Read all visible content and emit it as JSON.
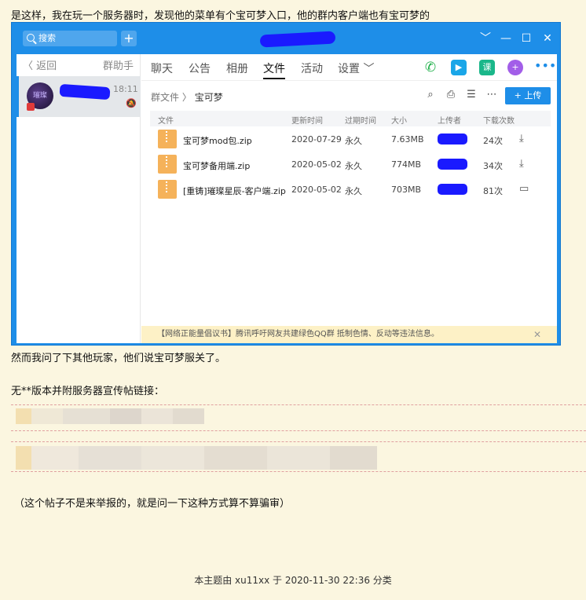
{
  "post": {
    "intro": "是这样，我在玩一个服务器时，发现他的菜单有个宝可梦入口，他的群内客户端也有宝可梦的",
    "after_screenshot": "然而我问了下其他玩家，他们说宝可梦服关了。",
    "links_intro": "无**版本并附服务器宣传帖链接：",
    "question": "（这个帖子不是来举报的，就是问一下这种方式算不算骗审）",
    "footer": "本主题由 xu11xx 于 2020-11-30 22:36 分类"
  },
  "qq_window": {
    "search_placeholder": "搜索",
    "add_symbol": "+",
    "controls": [
      "﹀",
      "—",
      "☐",
      "✕"
    ],
    "left_panel": {
      "back_label": "〈 返回",
      "assistant_label": "群助手",
      "chat_time": "18:11",
      "avatar_text": "璀璨"
    },
    "tabs": [
      "聊天",
      "公告",
      "相册",
      "文件",
      "活动",
      "设置 ﹀"
    ],
    "active_tab": "文件",
    "toolbar_icons": [
      "phone-icon",
      "video-icon",
      "class-icon",
      "plus-app-icon",
      "more-icon"
    ],
    "class_icon_text": "课",
    "plus_app_text": "+",
    "more_text": "•••",
    "path": {
      "root": "群文件",
      "separator": "〉",
      "current": "宝可梦"
    },
    "path_tool_icons": [
      "search-icon",
      "inbox-icon",
      "list-icon",
      "more-icon"
    ],
    "upload_label": "+ 上传",
    "columns": [
      "文件",
      "更新时间",
      "过期时间",
      "大小",
      "上传者",
      "下载次数"
    ],
    "files": [
      {
        "name": "宝可梦mod包.zip",
        "date": "2020-07-29",
        "expire": "永久",
        "size": "7.63MB",
        "downloads": "24次",
        "action_icon": "download-icon"
      },
      {
        "name": "宝可梦备用端.zip",
        "date": "2020-05-02",
        "expire": "永久",
        "size": "774MB",
        "downloads": "34次",
        "action_icon": "download-icon"
      },
      {
        "name": "[重铸]璀璨星辰-客户端.zip",
        "date": "2020-05-02",
        "expire": "永久",
        "size": "703MB",
        "downloads": "81次",
        "action_icon": "folder-icon"
      }
    ],
    "notice": "【网络正能量倡议书】腾讯呼吁网友共建绿色QQ群 抵制色情、反动等违法信息。",
    "notice_close": "✕"
  },
  "colors": {
    "page_bg": "#fbf6e0",
    "qq_blue": "#1e8ee8",
    "redaction": "#1a1aff",
    "zip_icon": "#f5b25a"
  }
}
